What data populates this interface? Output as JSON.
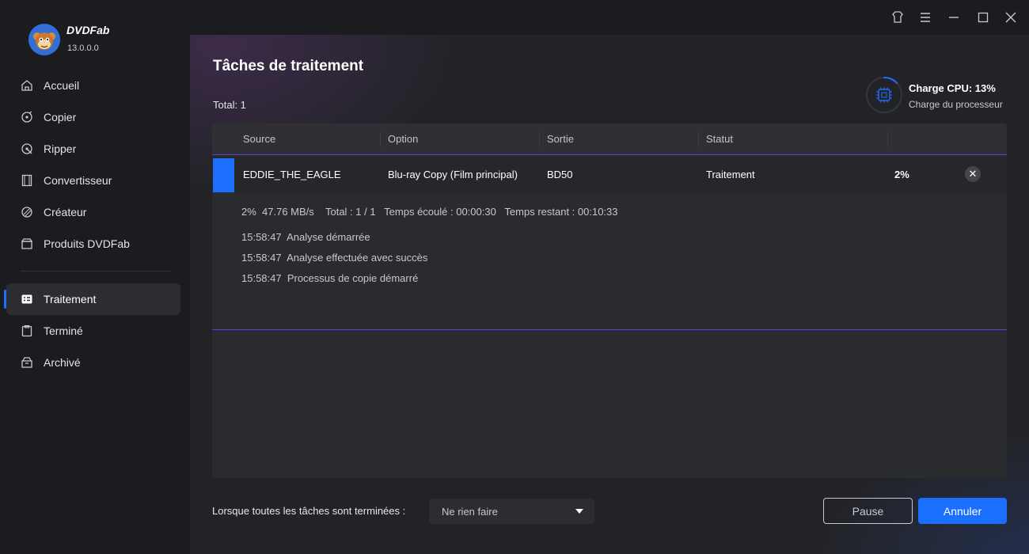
{
  "app": {
    "brand": "DVDFab",
    "version": "13.0.0.0"
  },
  "sidebar": {
    "items": [
      {
        "label": "Accueil",
        "icon": "home-icon"
      },
      {
        "label": "Copier",
        "icon": "copy-icon"
      },
      {
        "label": "Ripper",
        "icon": "ripper-icon"
      },
      {
        "label": "Convertisseur",
        "icon": "film-icon"
      },
      {
        "label": "Créateur",
        "icon": "creator-icon"
      },
      {
        "label": "Produits DVDFab",
        "icon": "products-icon"
      },
      {
        "label": "Traitement",
        "icon": "processing-icon",
        "active": true
      },
      {
        "label": "Terminé",
        "icon": "done-icon"
      },
      {
        "label": "Archivé",
        "icon": "archive-icon"
      }
    ]
  },
  "titlebar": {
    "icons": [
      "skin-icon",
      "menu-icon",
      "minimize-icon",
      "maximize-icon",
      "close-icon"
    ]
  },
  "main": {
    "title": "Tâches de traitement",
    "total": "Total: 1",
    "cpu": {
      "title": "Charge CPU: 13%",
      "subtitle": "Charge du processeur",
      "percent": 13,
      "color": "#1f6fff"
    },
    "table": {
      "headers": {
        "source": "Source",
        "option": "Option",
        "output": "Sortie",
        "status": "Statut"
      },
      "row": {
        "source": "EDDIE_THE_EAGLE",
        "option": "Blu-ray Copy (Film principal)",
        "output": "BD50",
        "status": "Traitement",
        "progress": "2%",
        "progress_fraction": 0.02
      },
      "details": {
        "stats": "2%  47.76 MB/s    Total : 1 / 1   Temps écoulé : 00:00:30   Temps restant : 00:10:33",
        "log": [
          "15:58:47  Analyse démarrée",
          "15:58:47  Analyse effectuée avec succès",
          "15:58:47  Processus de copie démarré"
        ]
      }
    },
    "footer": {
      "when_done_label": "Lorsque toutes les tâches sont terminées :",
      "when_done_value": "Ne rien faire",
      "pause_label": "Pause",
      "cancel_label": "Annuler"
    }
  },
  "colors": {
    "accent": "#1f6fff",
    "divider": "#5b3fd9"
  }
}
